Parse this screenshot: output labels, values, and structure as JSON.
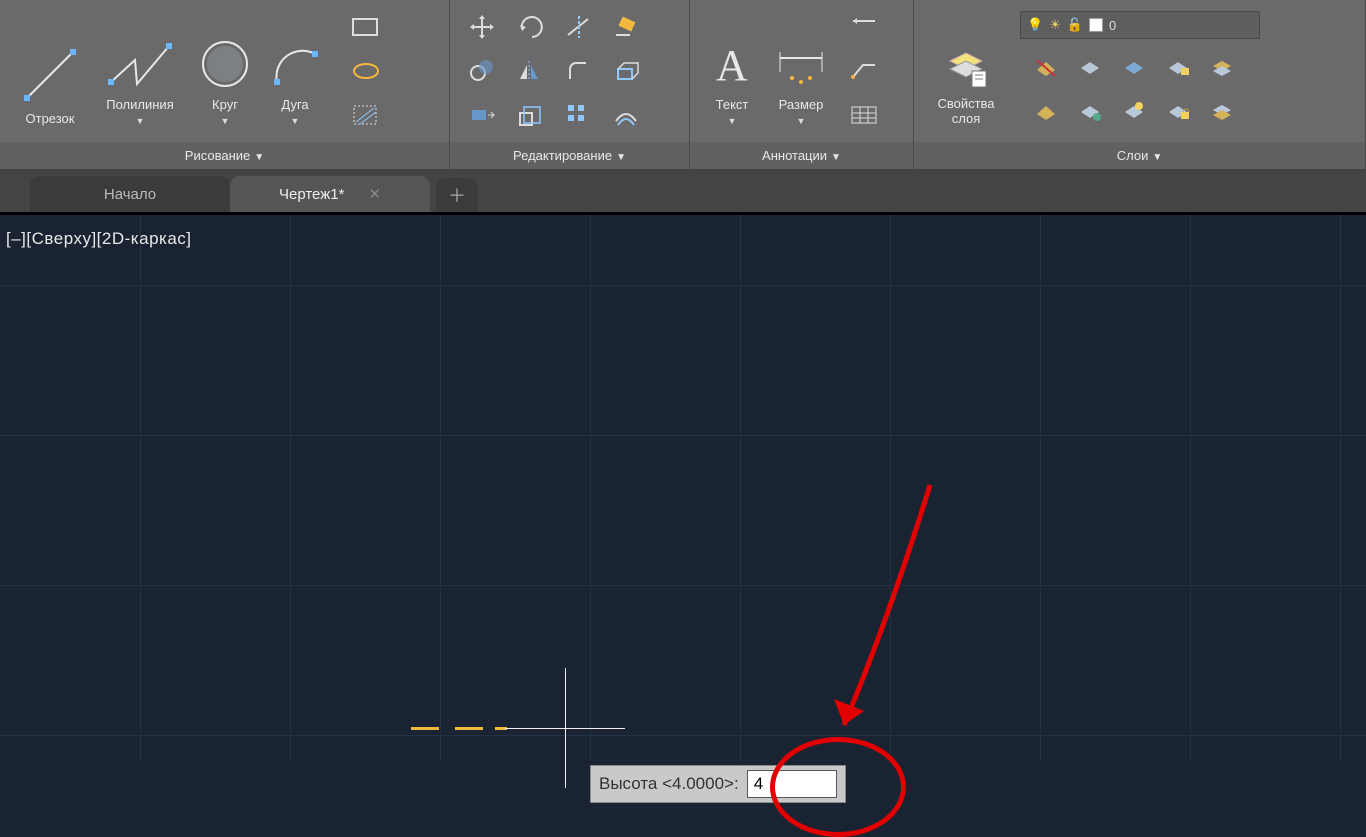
{
  "ribbon": {
    "panels": {
      "draw": {
        "title": "Рисование",
        "tools": {
          "line": "Отрезок",
          "polyline": "Полилиния",
          "circle": "Круг",
          "arc": "Дуга"
        }
      },
      "modify": {
        "title": "Редактирование"
      },
      "annotate": {
        "title": "Аннотации",
        "tools": {
          "text": "Текст",
          "dimension": "Размер"
        }
      },
      "layers": {
        "title": "Слои",
        "props_label": "Свойства\nслоя",
        "current_layer": "0"
      }
    }
  },
  "tabs": {
    "home": "Начало",
    "active": "Чертеж1*"
  },
  "canvas": {
    "view_label": "[–][Сверху][2D-каркас]",
    "prompt_label": "Высота <4.0000>:",
    "prompt_value": "4"
  }
}
